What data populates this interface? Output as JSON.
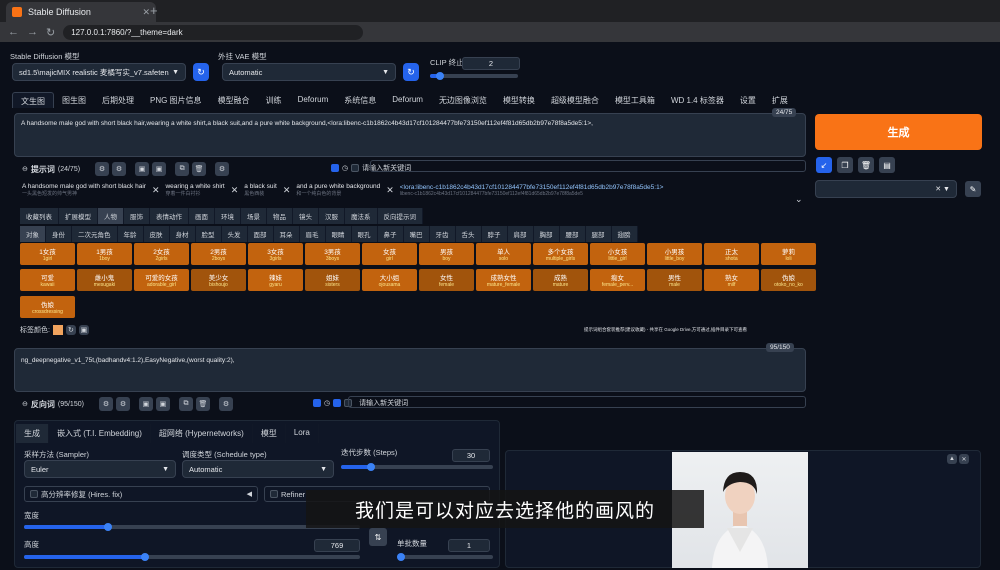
{
  "browser": {
    "tab_title": "Stable Diffusion",
    "url": "127.0.0.1:7860/?__theme=dark"
  },
  "top": {
    "model_label": "Stable Diffusion 模型",
    "model_value": "sd1.5\\majicMIX realistic 麦橘写实_v7.safetenso",
    "vae_label": "外挂 VAE 模型",
    "vae_value": "Automatic",
    "clip_label": "CLIP 终止层数",
    "clip_value": "2"
  },
  "main_tabs": [
    "文生图",
    "图生图",
    "后期处理",
    "PNG 图片信息",
    "模型融合",
    "训练",
    "Deforum",
    "系统信息",
    "Deforum",
    "无边图像浏览",
    "模型转换",
    "超级模型融合",
    "模型工具箱",
    "WD 1.4 标签器",
    "设置",
    "扩展"
  ],
  "prompt": {
    "text": "A handsome male god with short black hair,wearing a white shirt,a black suit,and a pure white background,<lora:libenc-c1b1862c4b43d17cf101284477bfe73150ef112ef4f81d65db2b97e78f8a5de5:1>,",
    "counter": "24/75",
    "label": "提示词",
    "count": "(24/75)",
    "keyword_placeholder": "请输入新关键词",
    "tokens": [
      {
        "text": "A handsome male god with short black hair",
        "sub": "一头黑色短发的帅气男神"
      },
      {
        "text": "wearing a white shirt",
        "sub": "穿着一件白衬衫"
      },
      {
        "text": "a black suit",
        "sub": "黑色西装"
      },
      {
        "text": "and a pure white background",
        "sub": "和一个纯白色的背景"
      },
      {
        "text": "<lora:libenc-c1b1862c4b43d17cf101284477bfe73150ef112ef4f81d65db2b97e78f8a5de5:1>",
        "sub": "libenc-c1b1862c4b43d17cf101284477bfe73150ef112ef4f81d65db2b97e78f8a5de5"
      }
    ]
  },
  "category_tabs": [
    "收藏列表",
    "扩展模型",
    "人物",
    "服饰",
    "表情动作",
    "画面",
    "环境",
    "场景",
    "物品",
    "镜头",
    "汉服",
    "魔法系",
    "反向提示词"
  ],
  "sub_tabs": [
    "对象",
    "身份",
    "二次元角色",
    "年龄",
    "皮肤",
    "身材",
    "脸型",
    "头发",
    "面部",
    "耳朵",
    "眉毛",
    "眼睛",
    "眼孔",
    "鼻子",
    "嘴巴",
    "牙齿",
    "舌头",
    "脖子",
    "肩部",
    "胸部",
    "腰部",
    "腿部",
    "翅膀"
  ],
  "tag_buttons_row1": [
    {
      "label": "1女孩",
      "sub": "1girl"
    },
    {
      "label": "1男孩",
      "sub": "1boy"
    },
    {
      "label": "2女孩",
      "sub": "2girls"
    },
    {
      "label": "2男孩",
      "sub": "2boys"
    },
    {
      "label": "3女孩",
      "sub": "3girls"
    },
    {
      "label": "3男孩",
      "sub": "3boys"
    },
    {
      "label": "女孩",
      "sub": "girl"
    },
    {
      "label": "男孩",
      "sub": "boy"
    },
    {
      "label": "单人",
      "sub": "solo"
    },
    {
      "label": "多个女孩",
      "sub": "multiple_girls"
    },
    {
      "label": "小女孩",
      "sub": "little_girl"
    },
    {
      "label": "小男孩",
      "sub": "little_boy"
    },
    {
      "label": "正太",
      "sub": "shota"
    },
    {
      "label": "萝莉",
      "sub": "loli"
    }
  ],
  "tag_buttons_row2": [
    {
      "label": "可爱",
      "sub": "kawaii"
    },
    {
      "label": "雌小鬼",
      "sub": "mesugaki"
    },
    {
      "label": "可爱的女孩",
      "sub": "adorable_girl"
    },
    {
      "label": "美少女",
      "sub": "bishoujo"
    },
    {
      "label": "辣妹",
      "sub": "gyaru"
    },
    {
      "label": "姐妹",
      "sub": "sisters"
    },
    {
      "label": "大小姐",
      "sub": "ojousama"
    },
    {
      "label": "女性",
      "sub": "female"
    },
    {
      "label": "成熟女性",
      "sub": "mature_female"
    },
    {
      "label": "成熟",
      "sub": "mature"
    },
    {
      "label": "痴女",
      "sub": "female_perv..."
    },
    {
      "label": "男性",
      "sub": "male"
    },
    {
      "label": "熟女",
      "sub": "milf"
    },
    {
      "label": "伪娘",
      "sub": "otoko_no_ko"
    }
  ],
  "tag_buttons_row3": [
    {
      "label": "伪娘",
      "sub": "crossdressing"
    }
  ],
  "tag_color_label": "标签颜色:",
  "hint_text": "提示词组合套装推荐(建议收藏) - 共享在 Google Drive,方可通过,插件目录下可查看",
  "negative": {
    "text": "ng_deepnegative_v1_75t,(badhandv4:1.2),EasyNegative,(worst quality:2),",
    "counter": "95/150",
    "label": "反向词",
    "count": "(95/150)",
    "keyword_placeholder": "请输入新关键词"
  },
  "generate_label": "生成",
  "bottom_tabs": [
    "生成",
    "嵌入式 (T.I. Embedding)",
    "超网络 (Hypernetworks)",
    "模型",
    "Lora"
  ],
  "sampler": {
    "label": "采样方法 (Sampler)",
    "value": "Euler"
  },
  "schedule": {
    "label": "调度类型 (Schedule type)",
    "value": "Automatic"
  },
  "steps": {
    "label": "迭代步数 (Steps)",
    "value": "30",
    "fraction": 0.2
  },
  "hires_label": "高分辨率修复 (Hires. fix)",
  "refiner_label": "Refiner",
  "width": {
    "label": "宽度",
    "fraction": 0.25
  },
  "height": {
    "label": "高度",
    "value": "769",
    "fraction": 0.36
  },
  "batch": {
    "label": "单批数量",
    "value": "1",
    "fraction": 0.0
  },
  "caption": "我们是可以对应去选择他的画风的"
}
